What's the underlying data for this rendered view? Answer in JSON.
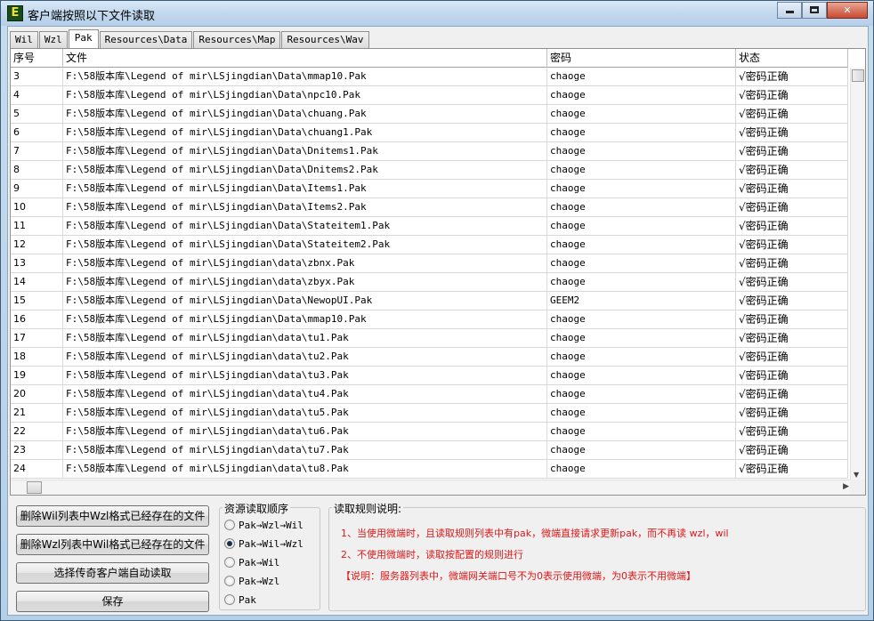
{
  "window": {
    "title": "客户端按照以下文件读取",
    "icon_letter": "E"
  },
  "tabs": [
    {
      "label": "Wil",
      "active": false
    },
    {
      "label": "Wzl",
      "active": false
    },
    {
      "label": "Pak",
      "active": true
    },
    {
      "label": "Resources\\Data",
      "active": false
    },
    {
      "label": "Resources\\Map",
      "active": false
    },
    {
      "label": "Resources\\Wav",
      "active": false
    }
  ],
  "grid": {
    "columns": [
      "序号",
      "文件",
      "密码",
      "状态"
    ],
    "rows": [
      [
        "3",
        "F:\\58版本库\\Legend of mir\\LSjingdian\\Data\\mmap10.Pak",
        "chaoge",
        "√密码正确"
      ],
      [
        "4",
        "F:\\58版本库\\Legend of mir\\LSjingdian\\Data\\npc10.Pak",
        "chaoge",
        "√密码正确"
      ],
      [
        "5",
        "F:\\58版本库\\Legend of mir\\LSjingdian\\Data\\chuang.Pak",
        "chaoge",
        "√密码正确"
      ],
      [
        "6",
        "F:\\58版本库\\Legend of mir\\LSjingdian\\Data\\chuang1.Pak",
        "chaoge",
        "√密码正确"
      ],
      [
        "7",
        "F:\\58版本库\\Legend of mir\\LSjingdian\\Data\\Dnitems1.Pak",
        "chaoge",
        "√密码正确"
      ],
      [
        "8",
        "F:\\58版本库\\Legend of mir\\LSjingdian\\Data\\Dnitems2.Pak",
        "chaoge",
        "√密码正确"
      ],
      [
        "9",
        "F:\\58版本库\\Legend of mir\\LSjingdian\\Data\\Items1.Pak",
        "chaoge",
        "√密码正确"
      ],
      [
        "10",
        "F:\\58版本库\\Legend of mir\\LSjingdian\\Data\\Items2.Pak",
        "chaoge",
        "√密码正确"
      ],
      [
        "11",
        "F:\\58版本库\\Legend of mir\\LSjingdian\\Data\\Stateitem1.Pak",
        "chaoge",
        "√密码正确"
      ],
      [
        "12",
        "F:\\58版本库\\Legend of mir\\LSjingdian\\Data\\Stateitem2.Pak",
        "chaoge",
        "√密码正确"
      ],
      [
        "13",
        "F:\\58版本库\\Legend of mir\\LSjingdian\\data\\zbnx.Pak",
        "chaoge",
        "√密码正确"
      ],
      [
        "14",
        "F:\\58版本库\\Legend of mir\\LSjingdian\\data\\zbyx.Pak",
        "chaoge",
        "√密码正确"
      ],
      [
        "15",
        "F:\\58版本库\\Legend of mir\\LSjingdian\\Data\\NewopUI.Pak",
        "GEEM2",
        "√密码正确"
      ],
      [
        "16",
        "F:\\58版本库\\Legend of mir\\LSjingdian\\Data\\mmap10.Pak",
        "chaoge",
        "√密码正确"
      ],
      [
        "17",
        "F:\\58版本库\\Legend of mir\\LSjingdian\\data\\tu1.Pak",
        "chaoge",
        "√密码正确"
      ],
      [
        "18",
        "F:\\58版本库\\Legend of mir\\LSjingdian\\data\\tu2.Pak",
        "chaoge",
        "√密码正确"
      ],
      [
        "19",
        "F:\\58版本库\\Legend of mir\\LSjingdian\\data\\tu3.Pak",
        "chaoge",
        "√密码正确"
      ],
      [
        "20",
        "F:\\58版本库\\Legend of mir\\LSjingdian\\data\\tu4.Pak",
        "chaoge",
        "√密码正确"
      ],
      [
        "21",
        "F:\\58版本库\\Legend of mir\\LSjingdian\\data\\tu5.Pak",
        "chaoge",
        "√密码正确"
      ],
      [
        "22",
        "F:\\58版本库\\Legend of mir\\LSjingdian\\data\\tu6.Pak",
        "chaoge",
        "√密码正确"
      ],
      [
        "23",
        "F:\\58版本库\\Legend of mir\\LSjingdian\\data\\tu7.Pak",
        "chaoge",
        "√密码正确"
      ],
      [
        "24",
        "F:\\58版本库\\Legend of mir\\LSjingdian\\data\\tu8.Pak",
        "chaoge",
        "√密码正确"
      ]
    ]
  },
  "buttons": {
    "delete_wil": "删除Wil列表中Wzl格式已经存在的文件",
    "delete_wzl": "删除Wzl列表中Wil格式已经存在的文件",
    "auto_read": "选择传奇客户端自动读取",
    "save": "保存"
  },
  "read_order": {
    "title": "资源读取顺序",
    "options": [
      {
        "label": "Pak→Wzl→Wil",
        "selected": false
      },
      {
        "label": "Pak→Wil→Wzl",
        "selected": true
      },
      {
        "label": "Pak→Wil",
        "selected": false
      },
      {
        "label": "Pak→Wzl",
        "selected": false
      },
      {
        "label": "Pak",
        "selected": false
      }
    ]
  },
  "rules": {
    "title": "读取规则说明:",
    "lines": [
      "1、当使用微端时，且读取规则列表中有pak，微端直接请求更新pak，而不再读 wzl，wil",
      "2、不使用微端时，读取按配置的规则进行",
      "【说明：服务器列表中，微端网关端口号不为0表示使用微端，为0表示不用微端】"
    ]
  }
}
